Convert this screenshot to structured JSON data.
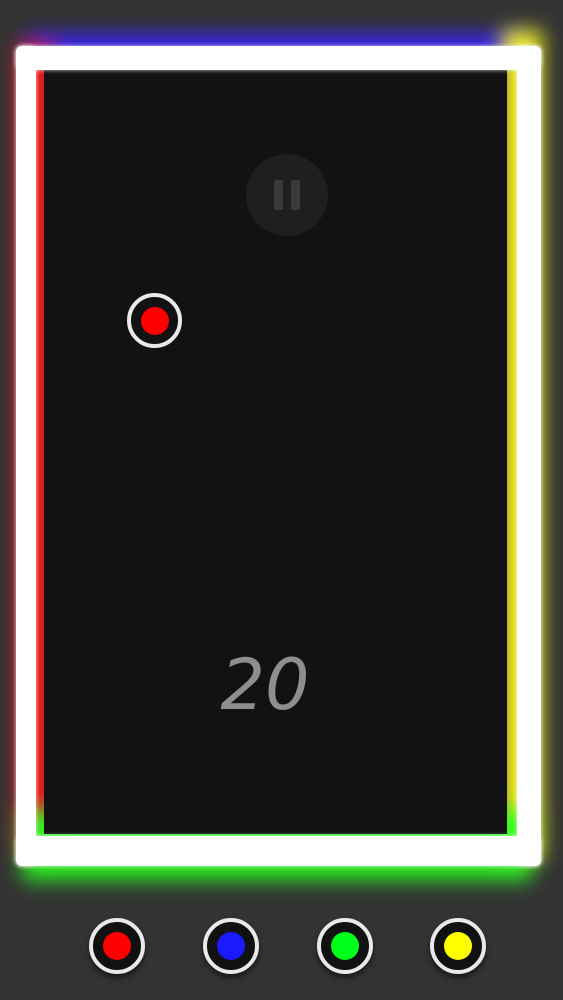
{
  "game": {
    "score": "20",
    "ball_color": "#ff0000",
    "wall_colors": {
      "top": "#3a22ff",
      "left": "#ff1a1a",
      "right": "#ffff22",
      "bottom": "#2bff22"
    },
    "controls": [
      {
        "name": "red",
        "color": "#ff0000"
      },
      {
        "name": "blue",
        "color": "#1a1aff"
      },
      {
        "name": "green",
        "color": "#00ff1a"
      },
      {
        "name": "yellow",
        "color": "#ffff00"
      }
    ],
    "background": "#333333",
    "arena_color": "#121113",
    "pause_icon": "pause-icon"
  }
}
